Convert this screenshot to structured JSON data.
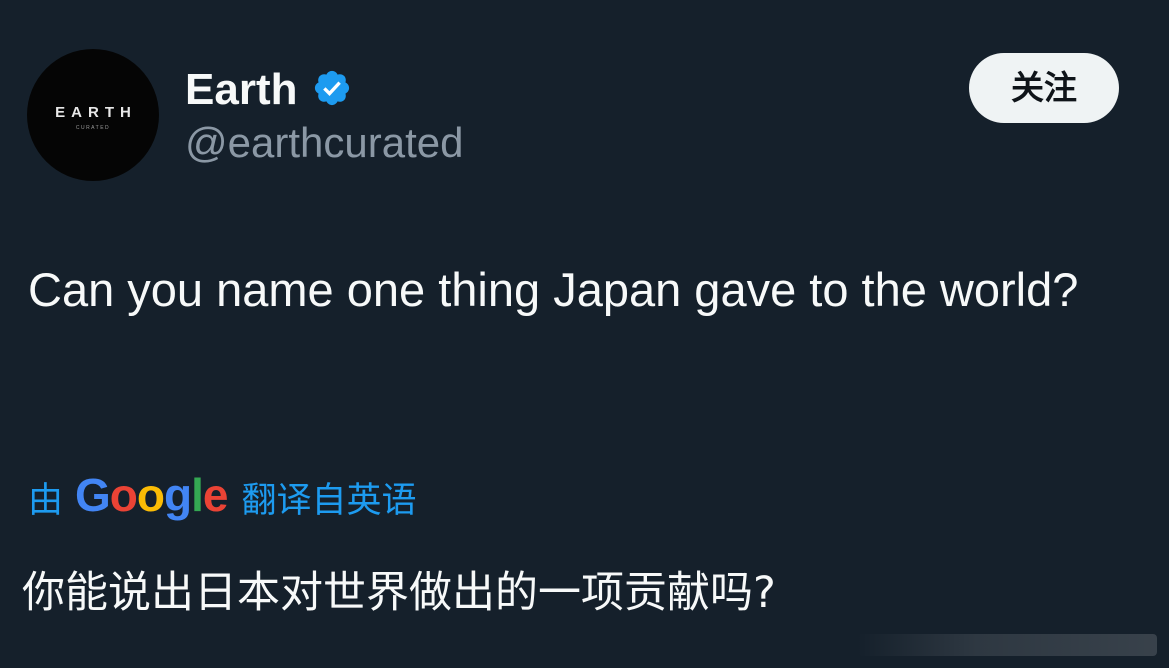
{
  "account": {
    "avatar_logo": "EARTH",
    "avatar_logo_sub": "CURATED",
    "display_name": "Earth",
    "handle": "@earthcurated",
    "verified_icon": "verified-badge-icon"
  },
  "follow_button": {
    "label": "关注"
  },
  "tweet": {
    "text": "Can you name one thing Japan gave to the world?",
    "translation": {
      "prefix": "由",
      "provider_letters": [
        "G",
        "o",
        "o",
        "g",
        "l",
        "e"
      ],
      "suffix": "翻译自英语",
      "text": "你能说出日本对世界做出的一项贡献吗?"
    }
  },
  "colors": {
    "background": "#15202b",
    "text_primary": "#f7f9f9",
    "text_secondary": "#8b98a5",
    "link_blue": "#1d9bf0",
    "verified_blue": "#1d9bf0",
    "follow_bg": "#eff3f4",
    "google_blue": "#4285f4",
    "google_red": "#ea4335",
    "google_yellow": "#fbbc05",
    "google_green": "#34a853"
  }
}
